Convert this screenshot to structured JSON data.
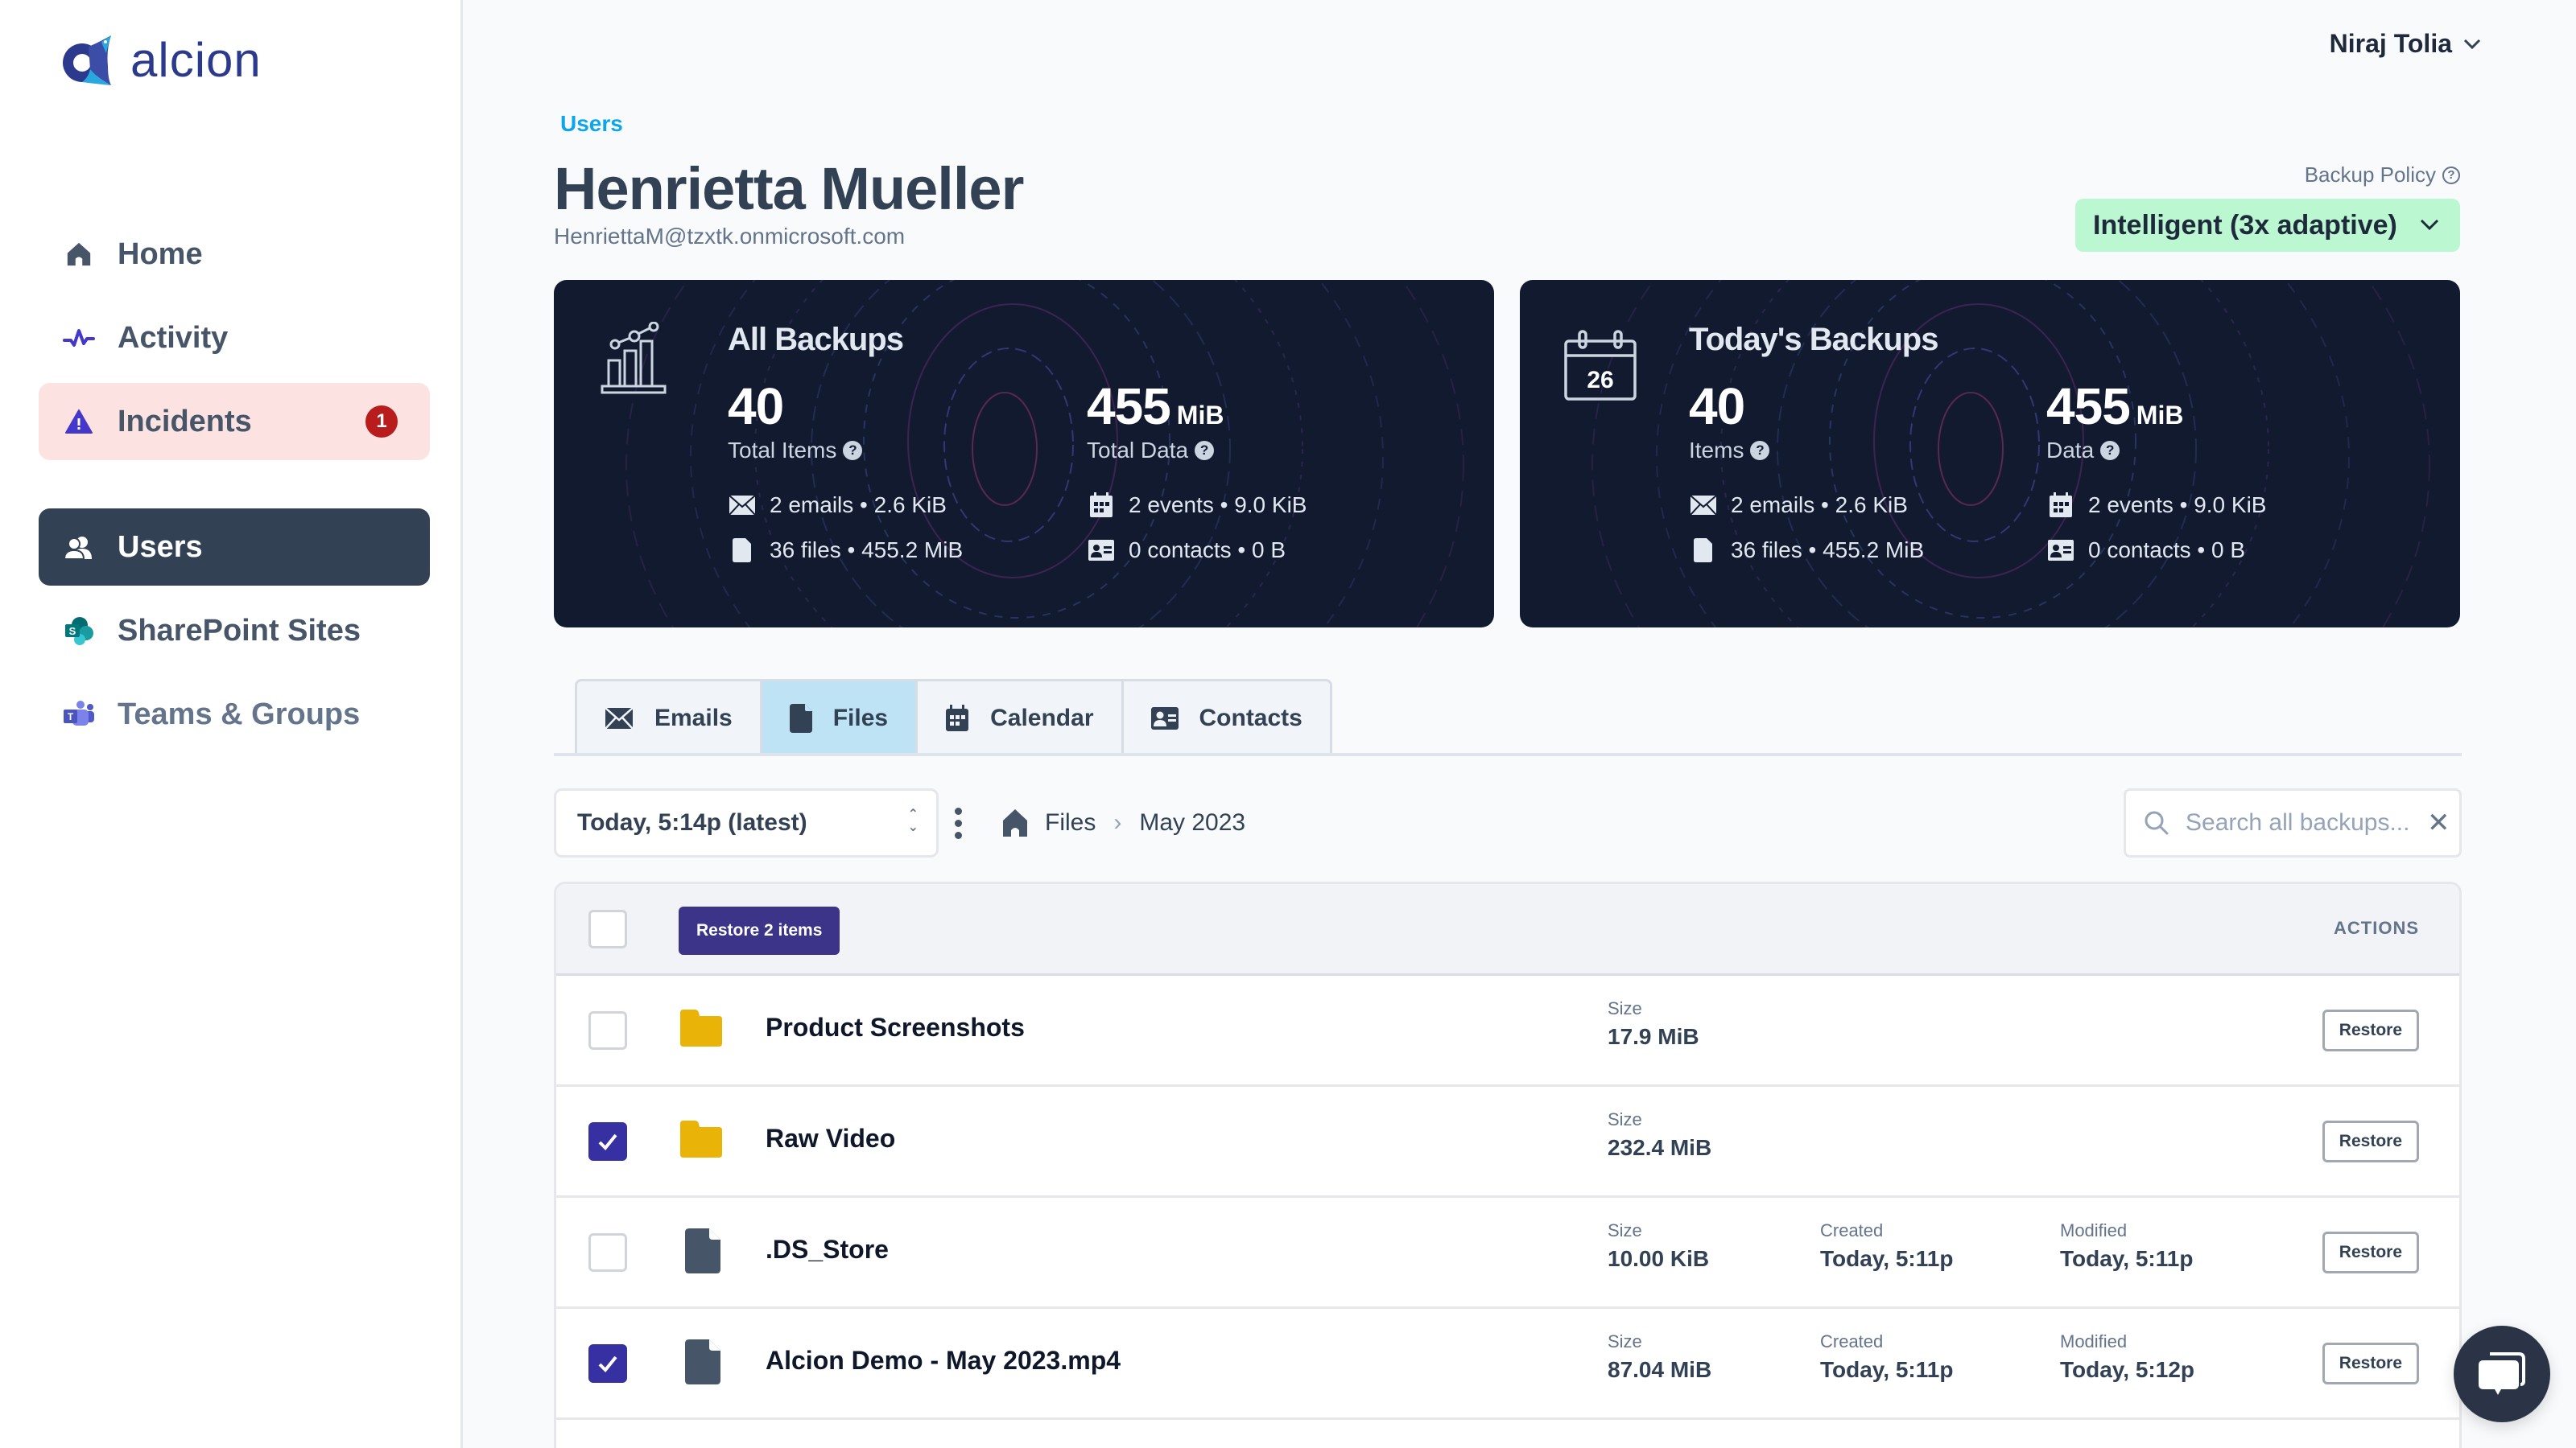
{
  "app": {
    "logo_text": "alcion",
    "brand_color": "#2b3a8c"
  },
  "sidebar": {
    "items": [
      {
        "label": "Home",
        "icon": "home-icon"
      },
      {
        "label": "Activity",
        "icon": "activity-icon"
      },
      {
        "label": "Incidents",
        "icon": "warning-icon",
        "badge": "1"
      },
      {
        "label": "Users",
        "icon": "users-icon",
        "active": true
      },
      {
        "label": "SharePoint Sites",
        "icon": "sharepoint-icon"
      },
      {
        "label": "Teams & Groups",
        "icon": "teams-icon"
      }
    ]
  },
  "header": {
    "user_name": "Niraj Tolia",
    "breadcrumb": "Users",
    "title": "Henrietta Mueller",
    "email": "HenriettaM@tzxtk.onmicrosoft.com",
    "backup_policy_label": "Backup Policy",
    "backup_policy_value": "Intelligent (3x adaptive)",
    "policy_color": "#bbf7d0"
  },
  "cards": [
    {
      "title": "All Backups",
      "icon": "chart-icon",
      "items_value": "40",
      "items_label": "Total Items",
      "data_value": "455",
      "data_unit": "MiB",
      "data_label": "Total Data",
      "emails": "2 emails • 2.6 KiB",
      "files": "36 files • 455.2 MiB",
      "events": "2 events • 9.0 KiB",
      "contacts": "0 contacts • 0 B"
    },
    {
      "title": "Today's Backups",
      "icon": "calendar-icon",
      "calendar_day": "26",
      "items_value": "40",
      "items_label": "Items",
      "data_value": "455",
      "data_unit": "MiB",
      "data_label": "Data",
      "emails": "2 emails • 2.6 KiB",
      "files": "36 files • 455.2 MiB",
      "events": "2 events • 9.0 KiB",
      "contacts": "0 contacts • 0 B"
    }
  ],
  "tabs": [
    {
      "label": "Emails",
      "icon": "mail-icon"
    },
    {
      "label": "Files",
      "icon": "file-icon",
      "active": true
    },
    {
      "label": "Calendar",
      "icon": "calendar-icon"
    },
    {
      "label": "Contacts",
      "icon": "contact-card-icon"
    }
  ],
  "toolbar": {
    "snapshot": "Today, 5:14p (latest)",
    "breadcrumbs": [
      "Files",
      "May 2023"
    ],
    "search_placeholder": "Search all backups...",
    "search_value": ""
  },
  "table": {
    "bulk_restore_label": "Restore 2 items",
    "actions_header": "ACTIONS",
    "size_label": "Size",
    "created_label": "Created",
    "modified_label": "Modified",
    "restore_label": "Restore",
    "rows": [
      {
        "name": "Product Screenshots",
        "type": "folder",
        "checked": false,
        "size": "17.9 MiB"
      },
      {
        "name": "Raw Video",
        "type": "folder",
        "checked": true,
        "size": "232.4 MiB"
      },
      {
        "name": ".DS_Store",
        "type": "file",
        "checked": false,
        "size": "10.00 KiB",
        "created": "Today, 5:11p",
        "modified": "Today, 5:11p"
      },
      {
        "name": "Alcion Demo - May 2023.mp4",
        "type": "file",
        "checked": true,
        "size": "87.04 MiB",
        "created": "Today, 5:11p",
        "modified": "Today, 5:12p"
      }
    ]
  }
}
